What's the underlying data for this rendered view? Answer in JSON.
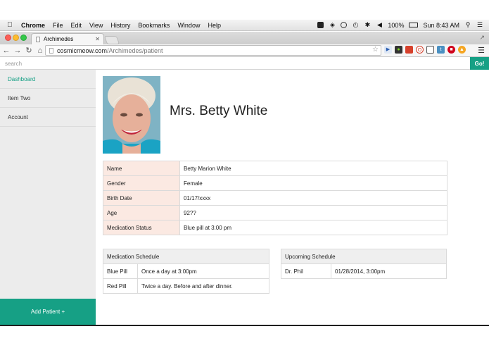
{
  "menubar": {
    "app": "Chrome",
    "items": [
      "File",
      "Edit",
      "View",
      "History",
      "Bookmarks",
      "Window",
      "Help"
    ],
    "battery": "100%",
    "clock": "Sun 8:43 AM"
  },
  "browser": {
    "tab_title": "Archimedes",
    "url_host": "cosmicmeow.com",
    "url_path": "/Archimedes/patient"
  },
  "site": {
    "search_placeholder": "search",
    "go_label": "Go!",
    "sidebar": [
      {
        "label": "Dashboard",
        "active": true
      },
      {
        "label": "Item Two",
        "active": false
      },
      {
        "label": "Account",
        "active": false
      }
    ],
    "add_patient_label": "Add Patient +"
  },
  "patient": {
    "title": "Mrs. Betty White",
    "details": [
      {
        "key": "Name",
        "value": "Betty Marion White"
      },
      {
        "key": "Gender",
        "value": "Female"
      },
      {
        "key": "Birth Date",
        "value": "01/17/xxxx"
      },
      {
        "key": "Age",
        "value": "92??"
      },
      {
        "key": "Medication Status",
        "value": "Blue pill at 3:00 pm"
      }
    ],
    "medication_schedule": {
      "heading": "Medication Schedule",
      "rows": [
        {
          "name": "Blue Pill",
          "when": "Once a day at 3:00pm"
        },
        {
          "name": "Red Pill",
          "when": "Twice a day. Before and after dinner."
        }
      ]
    },
    "upcoming_schedule": {
      "heading": "Upcoming Schedule",
      "rows": [
        {
          "name": "Dr. Phil",
          "when": "01/28/2014, 3:00pm"
        }
      ]
    }
  },
  "colors": {
    "accent": "#16a085",
    "key_cell": "#fbe9e2",
    "table_header": "#efefef"
  }
}
